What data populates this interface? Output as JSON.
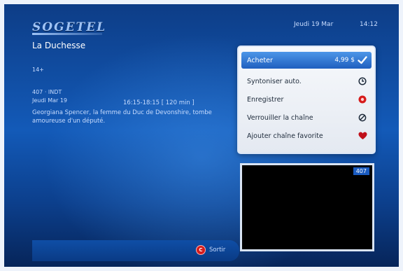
{
  "brand": {
    "logo": "SOGETEL"
  },
  "header": {
    "date": "Jeudi 19 Mar",
    "time": "14:12"
  },
  "program": {
    "title": "La Duchesse",
    "rating": "14+",
    "channel": "407 · INDT",
    "day": "Jeudi Mar 19",
    "time_range": "16:15-18:15  [ 120 min ]",
    "synopsis": "Georgiana Spencer, la femme du Duc de Devonshire, tombe amoureuse d'un député."
  },
  "menu": {
    "items": [
      {
        "label": "Acheter",
        "price": "4,99 $",
        "icon": "checkmark-icon"
      },
      {
        "label": "Syntoniser auto.",
        "icon": "clock-icon"
      },
      {
        "label": "Enregistrer",
        "icon": "record-icon"
      },
      {
        "label": "Verrouiller la chaîne",
        "icon": "lock-icon"
      },
      {
        "label": "Ajouter chaîne favorite",
        "icon": "heart-icon"
      }
    ]
  },
  "preview": {
    "channel": "407"
  },
  "footer": {
    "exit_key": "C",
    "exit_label": "Sortir"
  },
  "colors": {
    "accent": "#1f5fbf",
    "record": "#d61c1c",
    "favorite": "#c0101a"
  }
}
